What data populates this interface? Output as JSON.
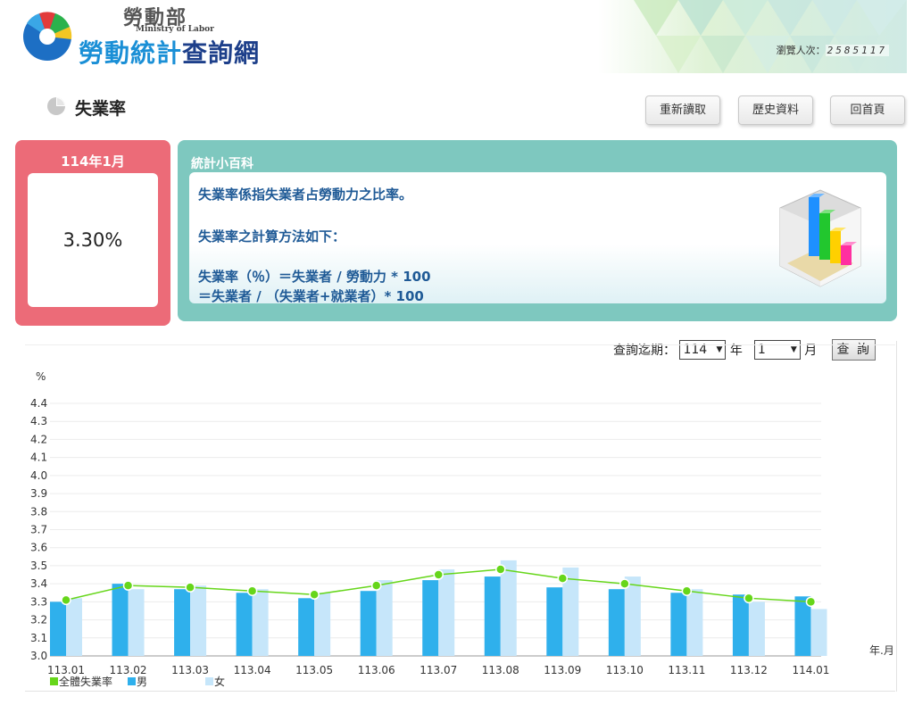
{
  "header": {
    "ministry_cn": "勞動部",
    "ministry_en": "Ministry of Labor",
    "site_name_a": "勞動統計",
    "site_name_b": "查詢網",
    "visitor_label": "瀏覽人次：",
    "visitor_count": "2585117"
  },
  "page": {
    "title": "失業率",
    "title_icon": "pie-chart-icon"
  },
  "toolbar": {
    "reload_label": "重新讀取",
    "history_label": "歷史資料",
    "home_label": "回首頁"
  },
  "rate": {
    "period": "114年1月",
    "value": "3.30%"
  },
  "info": {
    "title": "統計小百科",
    "line1": "失業率係指失業者占勞動力之比率。",
    "line2": "失業率之計算方法如下：",
    "line3": "失業率（％）＝失業者 / 勞動力 * 100",
    "line4": "＝失業者 / （失業者+就業者）* 100",
    "graphic_icon": "3d-bar-chart-icon"
  },
  "query": {
    "label": "查詢迄期：",
    "year_value": "114",
    "year_unit": "年",
    "month_value": "1",
    "month_unit": "月",
    "submit_label": "查 詢"
  },
  "colors": {
    "rate_card": "#ec6b78",
    "info_card": "#7ec8bf",
    "male_bar": "#2fb0ec",
    "female_bar": "#c6e6fa",
    "total_line": "#66d61a"
  },
  "chart_data": {
    "type": "bar",
    "ylabel": "%",
    "xlabel": "年.月",
    "ylim": [
      3.0,
      4.4
    ],
    "y_ticks": [
      "3.0",
      "3.1",
      "3.2",
      "3.3",
      "3.4",
      "3.5",
      "3.6",
      "3.7",
      "3.8",
      "3.9",
      "4.0",
      "4.1",
      "4.2",
      "4.3",
      "4.4"
    ],
    "categories": [
      "113.01",
      "113.02",
      "113.03",
      "113.04",
      "113.05",
      "113.06",
      "113.07",
      "113.08",
      "113.09",
      "113.10",
      "113.11",
      "113.12",
      "114.01"
    ],
    "series": [
      {
        "name": "全體失業率",
        "type": "line",
        "values": [
          3.31,
          3.39,
          3.38,
          3.36,
          3.34,
          3.39,
          3.45,
          3.48,
          3.43,
          3.4,
          3.36,
          3.32,
          3.3
        ]
      },
      {
        "name": "男",
        "type": "bar",
        "values": [
          3.3,
          3.4,
          3.37,
          3.35,
          3.32,
          3.36,
          3.42,
          3.44,
          3.38,
          3.37,
          3.35,
          3.34,
          3.33
        ]
      },
      {
        "name": "女",
        "type": "bar",
        "values": [
          3.32,
          3.37,
          3.39,
          3.37,
          3.35,
          3.42,
          3.48,
          3.53,
          3.49,
          3.44,
          3.37,
          3.3,
          3.26
        ]
      }
    ],
    "grid": true,
    "legend_position": "bottom-left"
  }
}
